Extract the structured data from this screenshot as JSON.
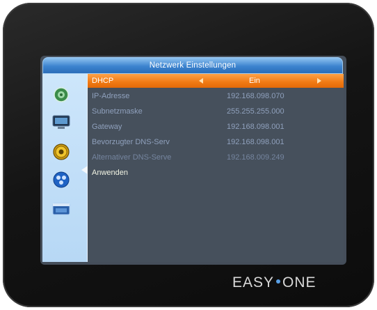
{
  "menu": {
    "title": "Netzwerk Einstellungen"
  },
  "sidebar": {
    "icons": [
      "globe-icon",
      "monitor-icon",
      "gear-icon",
      "satellite-icon",
      "media-icon"
    ],
    "selected_index": 2
  },
  "settings": {
    "rows": [
      {
        "label": "DHCP",
        "value": "Ein"
      },
      {
        "label": "IP-Adresse",
        "value": "192.168.098.070"
      },
      {
        "label": "Subnetzmaske",
        "value": "255.255.255.000"
      },
      {
        "label": "Gateway",
        "value": "192.168.098.001"
      },
      {
        "label": "Bevorzugter DNS-Serv",
        "value": "192.168.098.001"
      },
      {
        "label": "Alternativer DNS-Serve",
        "value": "192.168.009.249"
      }
    ],
    "apply_label": "Anwenden"
  },
  "brand": {
    "part1": "EASY",
    "part2": "ONE"
  },
  "colors": {
    "highlight": "#f07a14",
    "title_bar": "#3d84cf",
    "panel": "#46505c",
    "sidebar": "#c4e0f8",
    "text": "#8fa0bc"
  }
}
